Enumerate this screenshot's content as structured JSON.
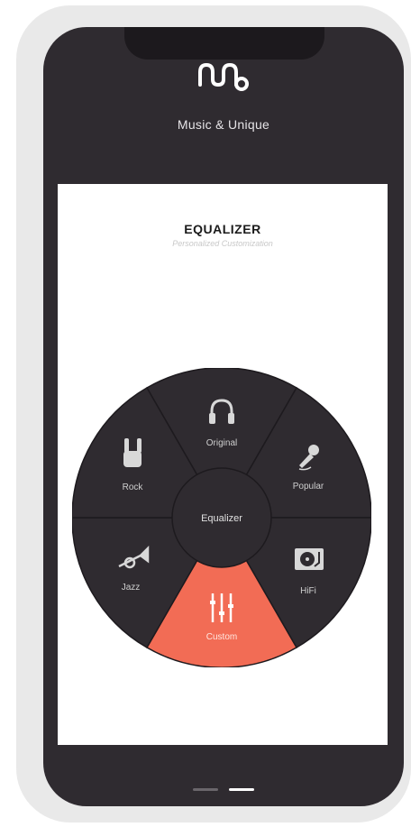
{
  "app": {
    "title": "Music & Unique"
  },
  "equalizer": {
    "title": "EQUALIZER",
    "subtitle": "Personalized Customization",
    "center_label": "Equalizer",
    "selected": "Custom",
    "presets": [
      {
        "label": "Original",
        "icon": "headphones-icon"
      },
      {
        "label": "Popular",
        "icon": "microphone-icon"
      },
      {
        "label": "HiFi",
        "icon": "turntable-icon"
      },
      {
        "label": "Custom",
        "icon": "sliders-icon"
      },
      {
        "label": "Jazz",
        "icon": "trumpet-icon"
      },
      {
        "label": "Rock",
        "icon": "rock-hand-icon"
      }
    ]
  },
  "colors": {
    "background": "#2f2b30",
    "accent": "#f26c55",
    "label": "#cfcfcf",
    "divider": "#1d1a1e"
  }
}
